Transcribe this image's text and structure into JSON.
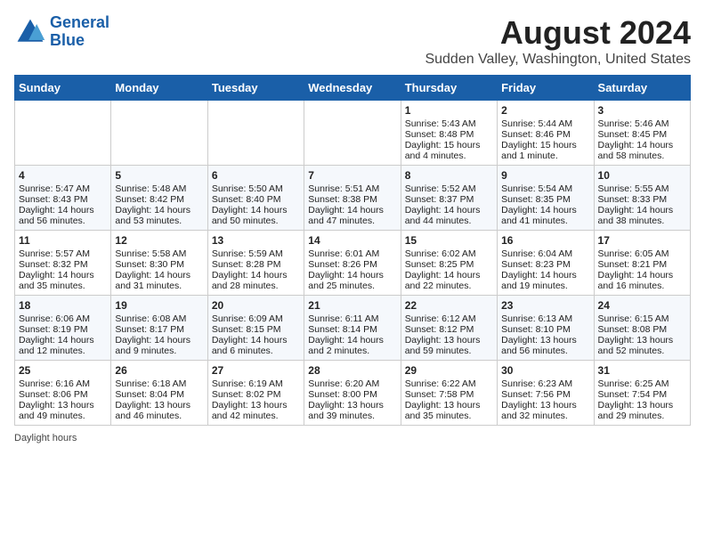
{
  "header": {
    "logo_line1": "General",
    "logo_line2": "Blue",
    "main_title": "August 2024",
    "subtitle": "Sudden Valley, Washington, United States"
  },
  "days_of_week": [
    "Sunday",
    "Monday",
    "Tuesday",
    "Wednesday",
    "Thursday",
    "Friday",
    "Saturday"
  ],
  "weeks": [
    [
      {
        "day": "",
        "sunrise": "",
        "sunset": "",
        "daylight": ""
      },
      {
        "day": "",
        "sunrise": "",
        "sunset": "",
        "daylight": ""
      },
      {
        "day": "",
        "sunrise": "",
        "sunset": "",
        "daylight": ""
      },
      {
        "day": "",
        "sunrise": "",
        "sunset": "",
        "daylight": ""
      },
      {
        "day": "1",
        "sunrise": "Sunrise: 5:43 AM",
        "sunset": "Sunset: 8:48 PM",
        "daylight": "Daylight: 15 hours and 4 minutes."
      },
      {
        "day": "2",
        "sunrise": "Sunrise: 5:44 AM",
        "sunset": "Sunset: 8:46 PM",
        "daylight": "Daylight: 15 hours and 1 minute."
      },
      {
        "day": "3",
        "sunrise": "Sunrise: 5:46 AM",
        "sunset": "Sunset: 8:45 PM",
        "daylight": "Daylight: 14 hours and 58 minutes."
      }
    ],
    [
      {
        "day": "4",
        "sunrise": "Sunrise: 5:47 AM",
        "sunset": "Sunset: 8:43 PM",
        "daylight": "Daylight: 14 hours and 56 minutes."
      },
      {
        "day": "5",
        "sunrise": "Sunrise: 5:48 AM",
        "sunset": "Sunset: 8:42 PM",
        "daylight": "Daylight: 14 hours and 53 minutes."
      },
      {
        "day": "6",
        "sunrise": "Sunrise: 5:50 AM",
        "sunset": "Sunset: 8:40 PM",
        "daylight": "Daylight: 14 hours and 50 minutes."
      },
      {
        "day": "7",
        "sunrise": "Sunrise: 5:51 AM",
        "sunset": "Sunset: 8:38 PM",
        "daylight": "Daylight: 14 hours and 47 minutes."
      },
      {
        "day": "8",
        "sunrise": "Sunrise: 5:52 AM",
        "sunset": "Sunset: 8:37 PM",
        "daylight": "Daylight: 14 hours and 44 minutes."
      },
      {
        "day": "9",
        "sunrise": "Sunrise: 5:54 AM",
        "sunset": "Sunset: 8:35 PM",
        "daylight": "Daylight: 14 hours and 41 minutes."
      },
      {
        "day": "10",
        "sunrise": "Sunrise: 5:55 AM",
        "sunset": "Sunset: 8:33 PM",
        "daylight": "Daylight: 14 hours and 38 minutes."
      }
    ],
    [
      {
        "day": "11",
        "sunrise": "Sunrise: 5:57 AM",
        "sunset": "Sunset: 8:32 PM",
        "daylight": "Daylight: 14 hours and 35 minutes."
      },
      {
        "day": "12",
        "sunrise": "Sunrise: 5:58 AM",
        "sunset": "Sunset: 8:30 PM",
        "daylight": "Daylight: 14 hours and 31 minutes."
      },
      {
        "day": "13",
        "sunrise": "Sunrise: 5:59 AM",
        "sunset": "Sunset: 8:28 PM",
        "daylight": "Daylight: 14 hours and 28 minutes."
      },
      {
        "day": "14",
        "sunrise": "Sunrise: 6:01 AM",
        "sunset": "Sunset: 8:26 PM",
        "daylight": "Daylight: 14 hours and 25 minutes."
      },
      {
        "day": "15",
        "sunrise": "Sunrise: 6:02 AM",
        "sunset": "Sunset: 8:25 PM",
        "daylight": "Daylight: 14 hours and 22 minutes."
      },
      {
        "day": "16",
        "sunrise": "Sunrise: 6:04 AM",
        "sunset": "Sunset: 8:23 PM",
        "daylight": "Daylight: 14 hours and 19 minutes."
      },
      {
        "day": "17",
        "sunrise": "Sunrise: 6:05 AM",
        "sunset": "Sunset: 8:21 PM",
        "daylight": "Daylight: 14 hours and 16 minutes."
      }
    ],
    [
      {
        "day": "18",
        "sunrise": "Sunrise: 6:06 AM",
        "sunset": "Sunset: 8:19 PM",
        "daylight": "Daylight: 14 hours and 12 minutes."
      },
      {
        "day": "19",
        "sunrise": "Sunrise: 6:08 AM",
        "sunset": "Sunset: 8:17 PM",
        "daylight": "Daylight: 14 hours and 9 minutes."
      },
      {
        "day": "20",
        "sunrise": "Sunrise: 6:09 AM",
        "sunset": "Sunset: 8:15 PM",
        "daylight": "Daylight: 14 hours and 6 minutes."
      },
      {
        "day": "21",
        "sunrise": "Sunrise: 6:11 AM",
        "sunset": "Sunset: 8:14 PM",
        "daylight": "Daylight: 14 hours and 2 minutes."
      },
      {
        "day": "22",
        "sunrise": "Sunrise: 6:12 AM",
        "sunset": "Sunset: 8:12 PM",
        "daylight": "Daylight: 13 hours and 59 minutes."
      },
      {
        "day": "23",
        "sunrise": "Sunrise: 6:13 AM",
        "sunset": "Sunset: 8:10 PM",
        "daylight": "Daylight: 13 hours and 56 minutes."
      },
      {
        "day": "24",
        "sunrise": "Sunrise: 6:15 AM",
        "sunset": "Sunset: 8:08 PM",
        "daylight": "Daylight: 13 hours and 52 minutes."
      }
    ],
    [
      {
        "day": "25",
        "sunrise": "Sunrise: 6:16 AM",
        "sunset": "Sunset: 8:06 PM",
        "daylight": "Daylight: 13 hours and 49 minutes."
      },
      {
        "day": "26",
        "sunrise": "Sunrise: 6:18 AM",
        "sunset": "Sunset: 8:04 PM",
        "daylight": "Daylight: 13 hours and 46 minutes."
      },
      {
        "day": "27",
        "sunrise": "Sunrise: 6:19 AM",
        "sunset": "Sunset: 8:02 PM",
        "daylight": "Daylight: 13 hours and 42 minutes."
      },
      {
        "day": "28",
        "sunrise": "Sunrise: 6:20 AM",
        "sunset": "Sunset: 8:00 PM",
        "daylight": "Daylight: 13 hours and 39 minutes."
      },
      {
        "day": "29",
        "sunrise": "Sunrise: 6:22 AM",
        "sunset": "Sunset: 7:58 PM",
        "daylight": "Daylight: 13 hours and 35 minutes."
      },
      {
        "day": "30",
        "sunrise": "Sunrise: 6:23 AM",
        "sunset": "Sunset: 7:56 PM",
        "daylight": "Daylight: 13 hours and 32 minutes."
      },
      {
        "day": "31",
        "sunrise": "Sunrise: 6:25 AM",
        "sunset": "Sunset: 7:54 PM",
        "daylight": "Daylight: 13 hours and 29 minutes."
      }
    ]
  ],
  "footer": {
    "note": "Daylight hours"
  }
}
